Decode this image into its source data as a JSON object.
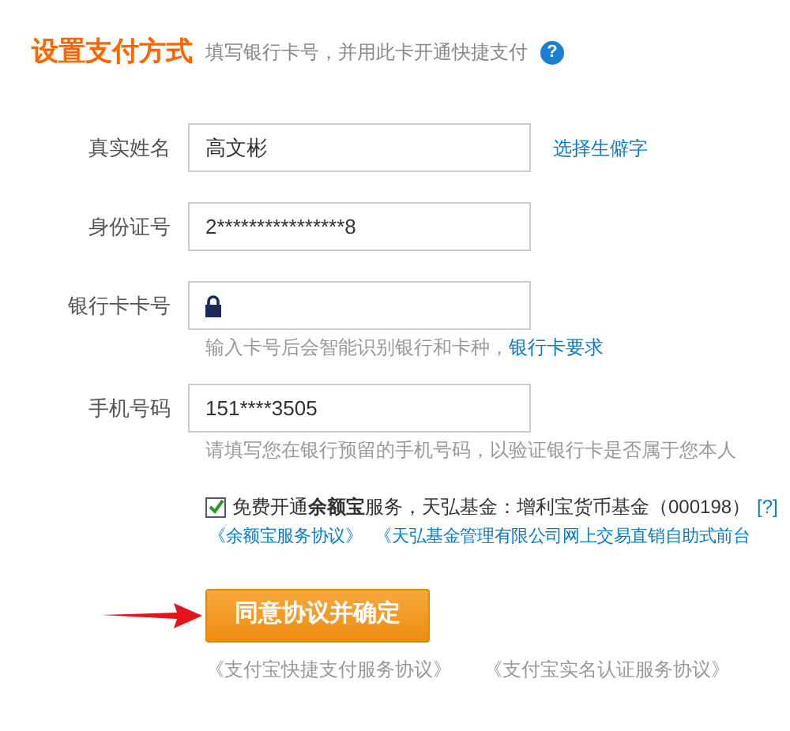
{
  "header": {
    "title": "设置支付方式",
    "subtitle": "填写银行卡号，并用此卡开通快捷支付",
    "help_icon": "?"
  },
  "fields": [
    {
      "label": "真实姓名",
      "value": "高文彬",
      "kind": "text",
      "link": "选择生僻字"
    },
    {
      "label": "身份证号",
      "value": "2****************8",
      "kind": "text"
    },
    {
      "label": "银行卡卡号",
      "kind": "secure",
      "hint": "输入卡号后会智能识别银行和卡种，",
      "hint_link": "银行卡要求"
    },
    {
      "label": "手机号码",
      "value": "151****3505",
      "kind": "text",
      "hint": "请填写您在银行预留的手机号码，以验证银行卡是否属于您本人"
    }
  ],
  "agreement": {
    "checked": true,
    "text": "免费开通**余额宝**服务，天弘基金：增利宝货币基金（000198）",
    "help_link": "[?]",
    "links": [
      "《余额宝服务协议》",
      "《天弘基金管理有限公司网上交易直销自助式前台"
    ]
  },
  "submit": "同意协议并确定",
  "footer_links": [
    "《支付宝快捷支付服务协议》",
    "《支付宝实名认证服务协议》"
  ]
}
